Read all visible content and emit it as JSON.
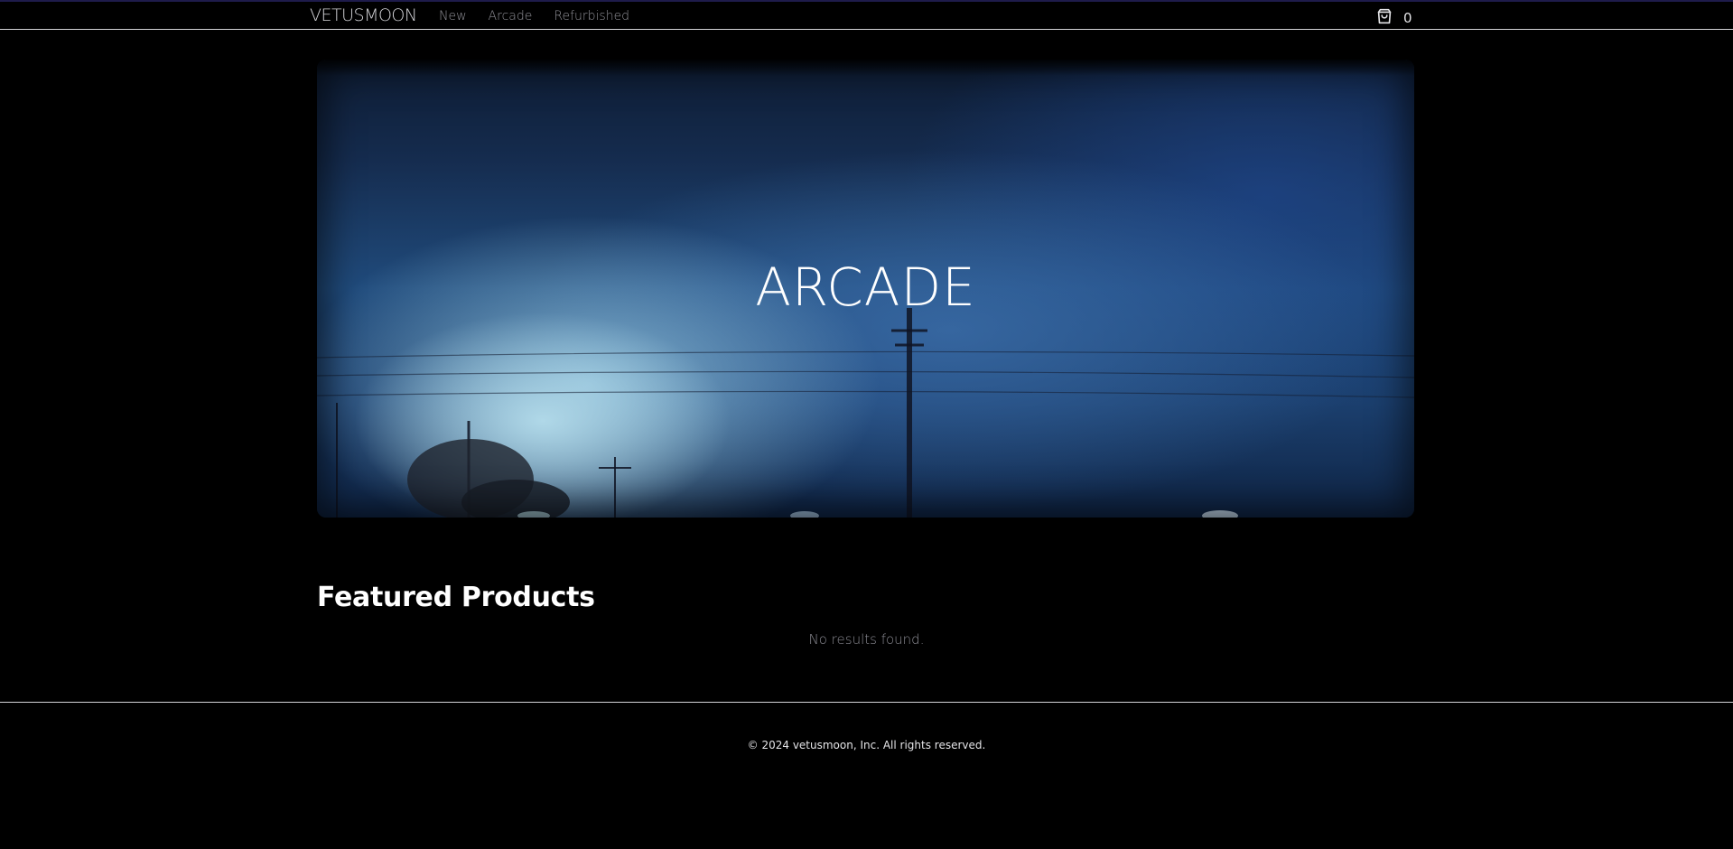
{
  "header": {
    "brand": "VETUSMOON",
    "nav": [
      {
        "label": "New"
      },
      {
        "label": "Arcade"
      },
      {
        "label": "Refurbished"
      }
    ],
    "cart": {
      "icon": "shopping-bag-icon",
      "count": "0"
    }
  },
  "hero": {
    "title": "ARCADE"
  },
  "featured": {
    "heading": "Featured Products",
    "empty_message": "No results found."
  },
  "footer": {
    "copyright": "© 2024 vetusmoon, Inc. All rights reserved."
  },
  "colors": {
    "background": "#000000",
    "text": "#ffffff",
    "muted": "#8a8a92",
    "divider": "#d4d4d8",
    "top_accent": "#1e1b4b"
  }
}
